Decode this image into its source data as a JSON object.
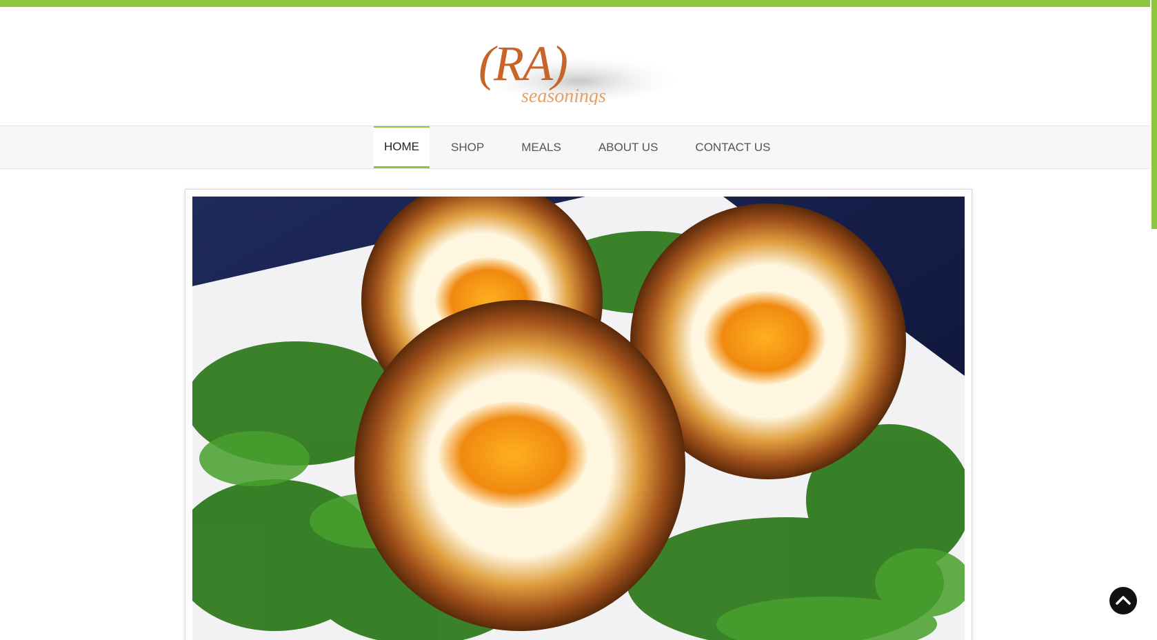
{
  "brand": {
    "logo_main": "(RA)",
    "logo_sub": "seasonings",
    "logo_color": "#c8642a",
    "logo_sub_color": "#e8a060"
  },
  "nav": {
    "items": [
      {
        "label": "HOME",
        "active": true
      },
      {
        "label": "SHOP",
        "active": false
      },
      {
        "label": "MEALS",
        "active": false
      },
      {
        "label": "ABOUT US",
        "active": false
      },
      {
        "label": "CONTACT US",
        "active": false
      }
    ]
  },
  "hero": {
    "image_icon": "food-photo-icon"
  },
  "controls": {
    "back_to_top_icon": "chevron-up-icon"
  },
  "colors": {
    "accent": "#8cc63f",
    "nav_bg": "#f7f7f7",
    "nav_text": "#555555"
  }
}
